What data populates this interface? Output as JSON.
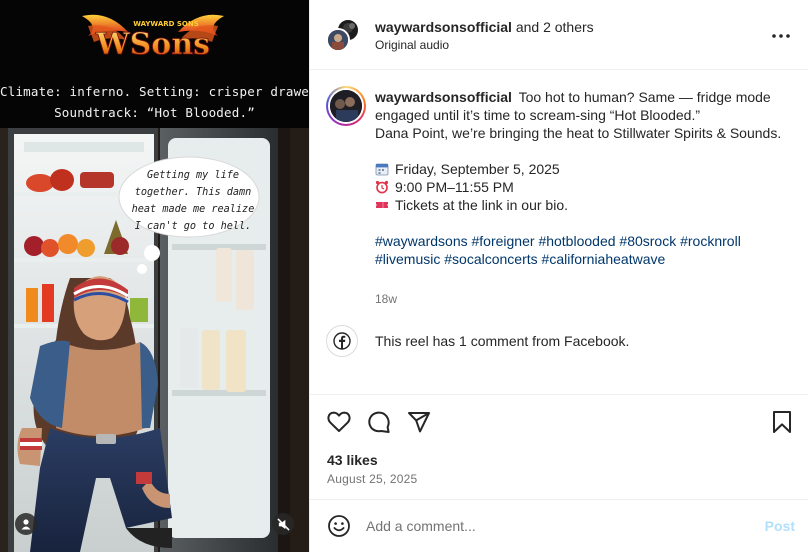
{
  "media": {
    "logo_text": "WAYWARD SONS",
    "caption_line1": "Climate: inferno. Setting: crisper drawer.",
    "caption_line2": "Soundtrack: “Hot Blooded.”",
    "thought_bubble": [
      "Getting my life",
      "together. This damn",
      "heat made me realize",
      "I can't go to hell."
    ],
    "user_tag_icon": "person-icon",
    "mute_icon": "speaker-muted-icon"
  },
  "header": {
    "username": "waywardsonsofficial",
    "and_others": " and 2 others",
    "audio": "Original audio",
    "more_icon": "more-horizontal-icon"
  },
  "caption": {
    "username": "waywardsonsofficial",
    "text_line1": "Too hot to human? Same — fridge mode engaged until it’s time to scream-sing “Hot Blooded.”",
    "text_line2": "Dana Point, we’re bringing the heat to Stillwater Spirits & Sounds.",
    "event_date": "Friday, September 5, 2025",
    "event_time": "9:00 PM–11:55 PM",
    "event_tickets": "Tickets at the link in our bio.",
    "hashtags": [
      "#waywardsons",
      "#foreigner",
      "#hotblooded",
      "#80srock",
      "#rocknroll",
      "#livemusic",
      "#socalconcerts",
      "#californiaheatwave"
    ],
    "age": "18w"
  },
  "facebook_note": {
    "icon": "facebook-icon",
    "text": "This reel has 1 comment from Facebook."
  },
  "actions": {
    "like_icon": "heart-icon",
    "comment_icon": "comment-bubble-icon",
    "share_icon": "paper-plane-icon",
    "save_icon": "bookmark-icon",
    "likes": "43 likes",
    "date": "August 25, 2025"
  },
  "comment_bar": {
    "emoji_icon": "smiley-icon",
    "placeholder": "Add a comment...",
    "post_label": "Post"
  },
  "colors": {
    "link_blue": "#00376b",
    "post_disabled": "#b2dffc",
    "muted_text": "#737373",
    "divider": "#efefef"
  }
}
